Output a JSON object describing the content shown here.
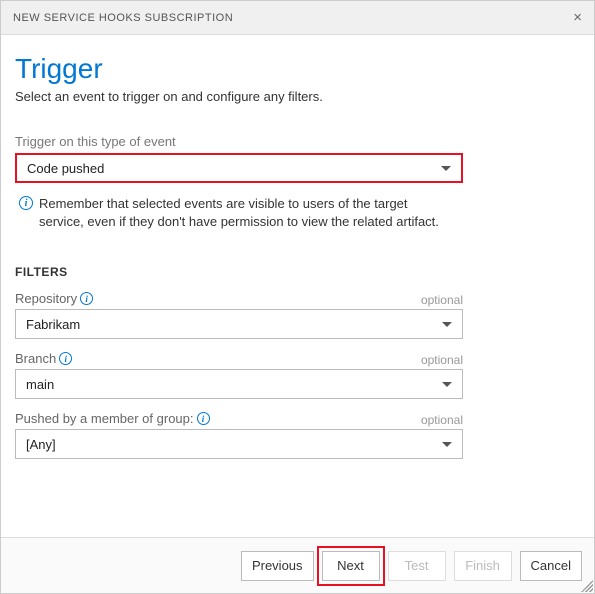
{
  "header": {
    "title": "NEW SERVICE HOOKS SUBSCRIPTION"
  },
  "page": {
    "title": "Trigger",
    "subtitle": "Select an event to trigger on and configure any filters."
  },
  "eventField": {
    "label": "Trigger on this type of event",
    "value": "Code pushed"
  },
  "infoNote": "Remember that selected events are visible to users of the target service, even if they don't have permission to view the related artifact.",
  "filtersHeading": "FILTERS",
  "filters": {
    "repository": {
      "label": "Repository",
      "value": "Fabrikam",
      "optional": "optional"
    },
    "branch": {
      "label": "Branch",
      "value": "main",
      "optional": "optional"
    },
    "group": {
      "label": "Pushed by a member of group:",
      "value": "[Any]",
      "optional": "optional"
    }
  },
  "footer": {
    "previous": "Previous",
    "next": "Next",
    "test": "Test",
    "finish": "Finish",
    "cancel": "Cancel"
  }
}
